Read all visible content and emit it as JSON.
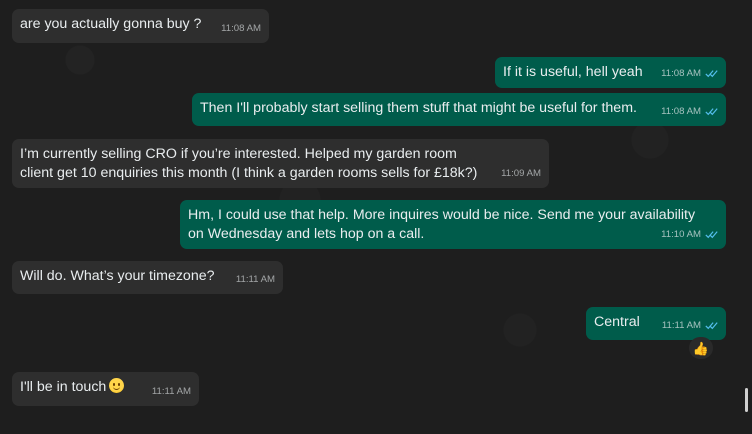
{
  "messages": [
    {
      "id": "m1",
      "direction": "incoming",
      "text": "are you actually gonna buy ?",
      "time": "11:08 AM"
    },
    {
      "id": "m2",
      "direction": "outgoing",
      "text": "If it is useful, hell yeah",
      "time": "11:08 AM",
      "status": "read"
    },
    {
      "id": "m3",
      "direction": "outgoing",
      "text": "Then I'll probably start selling them stuff that might be useful for them.",
      "time": "11:08 AM",
      "status": "read"
    },
    {
      "id": "m4",
      "direction": "incoming",
      "text": "I’m currently selling CRO if you’re interested. Helped my garden room client get 10 enquiries this month (I think a garden rooms sells for £18k?)",
      "time": "11:09 AM"
    },
    {
      "id": "m5",
      "direction": "outgoing",
      "text": "Hm, I could use that help. More inquires would be nice. Send me your availability on Wednesday and lets hop on a call.",
      "time": "11:10 AM",
      "status": "read"
    },
    {
      "id": "m6",
      "direction": "incoming",
      "text": "Will do. What’s your timezone?",
      "time": "11:11 AM"
    },
    {
      "id": "m7",
      "direction": "outgoing",
      "text": "Central",
      "time": "11:11 AM",
      "status": "read",
      "reaction": "👍"
    },
    {
      "id": "m8",
      "direction": "incoming",
      "text": "I'll be in touch",
      "emoji": "smiling-face-icon",
      "time": "11:11 AM"
    }
  ],
  "colors": {
    "background": "#1e1e1e",
    "incoming_bubble": "#2e2e2e",
    "outgoing_bubble": "#005c4b",
    "text": "#e9edef"
  }
}
